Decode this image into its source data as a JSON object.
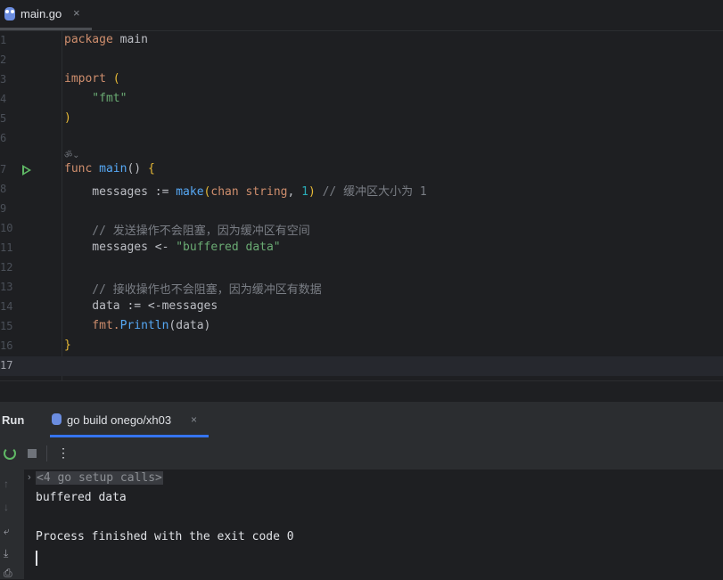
{
  "editor_tab": {
    "label": "main.go",
    "close": "×"
  },
  "editor": {
    "line_numbers": [
      "1",
      "2",
      "3",
      "4",
      "5",
      "6",
      "7",
      "8",
      "9",
      "10",
      "11",
      "12",
      "13",
      "14",
      "15",
      "16",
      "17"
    ],
    "inlay_hint": "ॐ⌄",
    "lines": {
      "l1_kw": "package",
      "l1_rest": " main",
      "l3_kw": "import",
      "l3_br": " (",
      "l4_str": "    \"fmt\"",
      "l5_br": ")",
      "l7_kw": "func",
      "l7_fn": " main",
      "l7_rest": "() ",
      "l7_br": "{",
      "l8_a": "    messages := ",
      "l8_fn": "make",
      "l8_p1": "(",
      "l8_kw": "chan string",
      "l8_c": ", ",
      "l8_num": "1",
      "l8_p2": ") ",
      "l8_cm": "// 缓冲区大小为 1",
      "l10_cm": "    // 发送操作不会阻塞，因为缓冲区有空间",
      "l11_a": "    messages <- ",
      "l11_str": "\"buffered data\"",
      "l13_cm": "    // 接收操作也不会阻塞，因为缓冲区有数据",
      "l14_a": "    data := <-messages",
      "l15_pkg": "    fmt.",
      "l15_fn": "Println",
      "l15_rest": "(data)",
      "l16_br": "}"
    }
  },
  "run_panel": {
    "title": "Run",
    "tab_label": "go build onego/xh03",
    "tab_close": "×",
    "toolbar": {
      "more": "⋮"
    },
    "console": {
      "folded_label": "<4 go setup calls>",
      "fold_arrow": "›",
      "output_line": "buffered data",
      "exit_line": "Process finished with the exit code 0"
    },
    "gutter_icons": {
      "up": "↑",
      "down": "↓",
      "wrap": "⤶",
      "scroll": "⤓",
      "print": "⎙"
    }
  }
}
